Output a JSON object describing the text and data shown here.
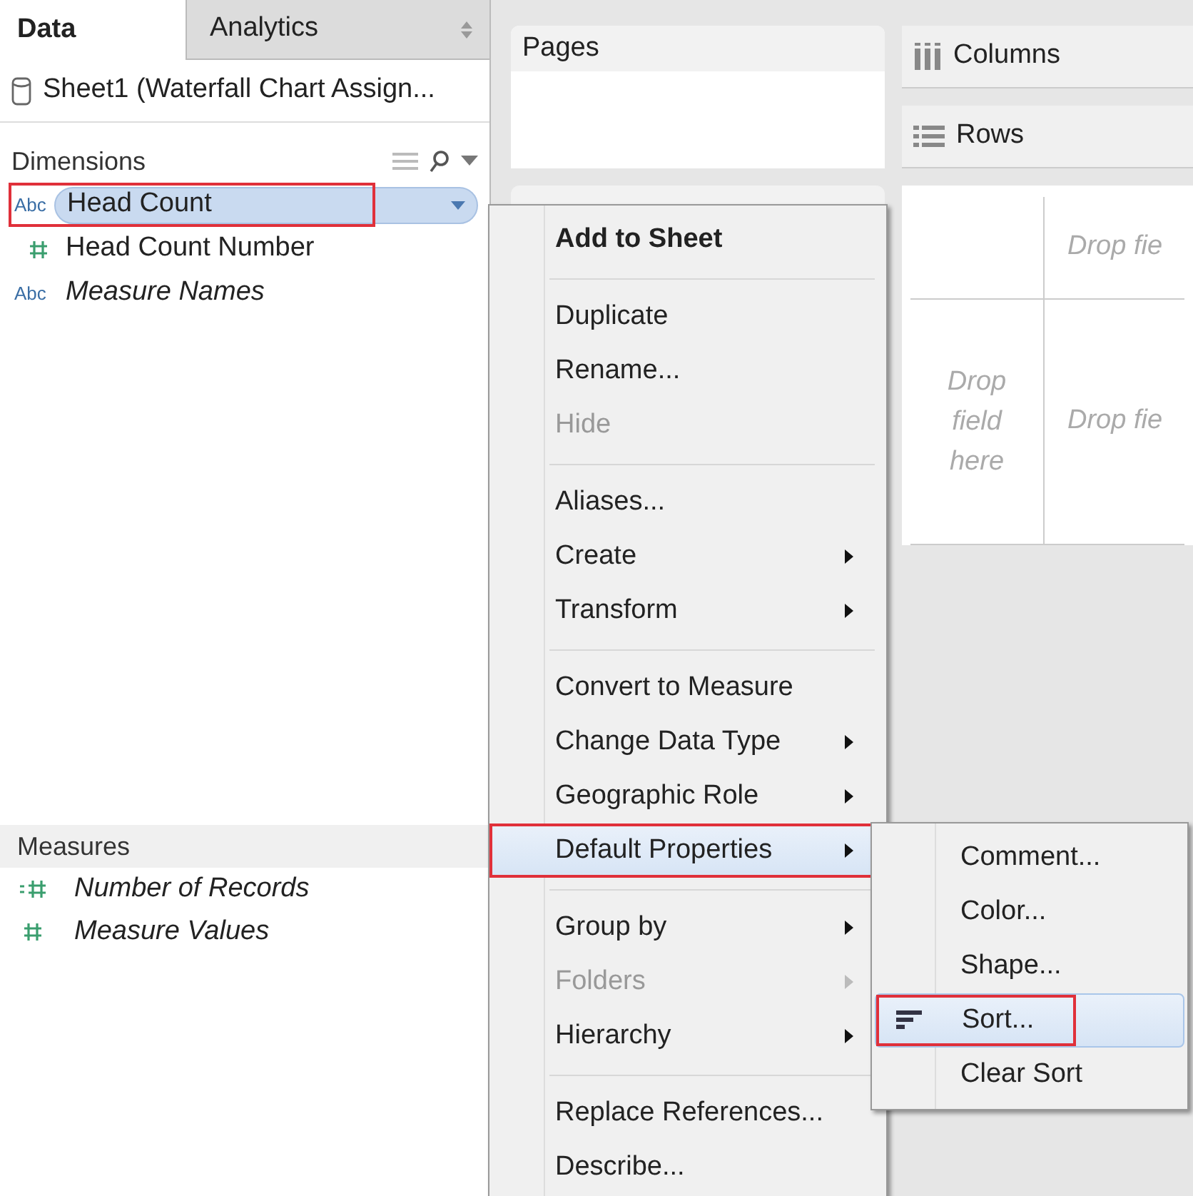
{
  "sidebar": {
    "tabs": [
      {
        "label": "Data",
        "selected": true
      },
      {
        "label": "Analytics",
        "selected": false
      }
    ],
    "data_source": "Sheet1 (Waterfall Chart Assign...",
    "dimensions": {
      "title": "Dimensions",
      "items": [
        {
          "kind": "string",
          "badge": "Abc",
          "label": "Head Count",
          "italic": false,
          "selected": true,
          "highlighted": true
        },
        {
          "kind": "number",
          "label": "Head Count Number",
          "italic": false,
          "selected": false,
          "highlighted": false
        },
        {
          "kind": "string",
          "badge": "Abc",
          "label": "Measure Names",
          "italic": true,
          "selected": false,
          "highlighted": false
        }
      ]
    },
    "measures": {
      "title": "Measures",
      "items": [
        {
          "kind": "calc",
          "label": "Number of Records"
        },
        {
          "kind": "number",
          "label": "Measure Values"
        }
      ]
    }
  },
  "shelves": {
    "pages": "Pages",
    "columns": "Columns",
    "rows": "Rows"
  },
  "canvas": {
    "top_drop": "Drop fie",
    "left_drop": "Drop\nfield\nhere",
    "center_drop": "Drop fie"
  },
  "context_menu": {
    "items": [
      {
        "kind": "item",
        "label": "Add to Sheet",
        "bold": true,
        "disabled": false,
        "submenu": false,
        "selected": false,
        "highlighted": false
      },
      {
        "kind": "separator"
      },
      {
        "kind": "item",
        "label": "Duplicate",
        "bold": false,
        "disabled": false,
        "submenu": false,
        "selected": false,
        "highlighted": false
      },
      {
        "kind": "item",
        "label": "Rename...",
        "bold": false,
        "disabled": false,
        "submenu": false,
        "selected": false,
        "highlighted": false
      },
      {
        "kind": "item",
        "label": "Hide",
        "bold": false,
        "disabled": true,
        "submenu": false,
        "selected": false,
        "highlighted": false
      },
      {
        "kind": "separator"
      },
      {
        "kind": "item",
        "label": "Aliases...",
        "bold": false,
        "disabled": false,
        "submenu": false,
        "selected": false,
        "highlighted": false
      },
      {
        "kind": "item",
        "label": "Create",
        "bold": false,
        "disabled": false,
        "submenu": true,
        "selected": false,
        "highlighted": false
      },
      {
        "kind": "item",
        "label": "Transform",
        "bold": false,
        "disabled": false,
        "submenu": true,
        "selected": false,
        "highlighted": false
      },
      {
        "kind": "separator"
      },
      {
        "kind": "item",
        "label": "Convert to Measure",
        "bold": false,
        "disabled": false,
        "submenu": false,
        "selected": false,
        "highlighted": false
      },
      {
        "kind": "item",
        "label": "Change Data Type",
        "bold": false,
        "disabled": false,
        "submenu": true,
        "selected": false,
        "highlighted": false
      },
      {
        "kind": "item",
        "label": "Geographic Role",
        "bold": false,
        "disabled": false,
        "submenu": true,
        "selected": false,
        "highlighted": false
      },
      {
        "kind": "item",
        "label": "Default Properties",
        "bold": false,
        "disabled": false,
        "submenu": true,
        "selected": true,
        "highlighted": true
      },
      {
        "kind": "separator"
      },
      {
        "kind": "item",
        "label": "Group by",
        "bold": false,
        "disabled": false,
        "submenu": true,
        "selected": false,
        "highlighted": false
      },
      {
        "kind": "item",
        "label": "Folders",
        "bold": false,
        "disabled": true,
        "submenu": true,
        "selected": false,
        "highlighted": false
      },
      {
        "kind": "item",
        "label": "Hierarchy",
        "bold": false,
        "disabled": false,
        "submenu": true,
        "selected": false,
        "highlighted": false
      },
      {
        "kind": "separator"
      },
      {
        "kind": "item",
        "label": "Replace References...",
        "bold": false,
        "disabled": false,
        "submenu": false,
        "selected": false,
        "highlighted": false
      },
      {
        "kind": "item",
        "label": "Describe...",
        "bold": false,
        "disabled": false,
        "submenu": false,
        "selected": false,
        "highlighted": false
      }
    ]
  },
  "submenu": {
    "items": [
      {
        "label": "Comment...",
        "icon": false,
        "selected": false,
        "highlighted": false
      },
      {
        "label": "Color...",
        "icon": false,
        "selected": false,
        "highlighted": false
      },
      {
        "label": "Shape...",
        "icon": false,
        "selected": false,
        "highlighted": false
      },
      {
        "label": "Sort...",
        "icon": true,
        "selected": true,
        "highlighted": true
      },
      {
        "label": "Clear Sort",
        "icon": false,
        "selected": false,
        "highlighted": false
      }
    ]
  }
}
